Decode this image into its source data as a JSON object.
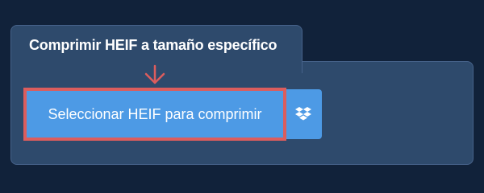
{
  "tab": {
    "title": "Comprimir HEIF a tamaño específico"
  },
  "upload": {
    "button_label": "Seleccionar HEIF para comprimir"
  },
  "dropbox": {
    "icon": "dropbox-icon"
  },
  "arrow": {
    "icon": "arrow-down-icon"
  },
  "colors": {
    "background": "#11223a",
    "panel": "#2e4a6c",
    "button": "#4d9ae5",
    "highlight": "#dc5d5d",
    "text": "#ffffff"
  }
}
